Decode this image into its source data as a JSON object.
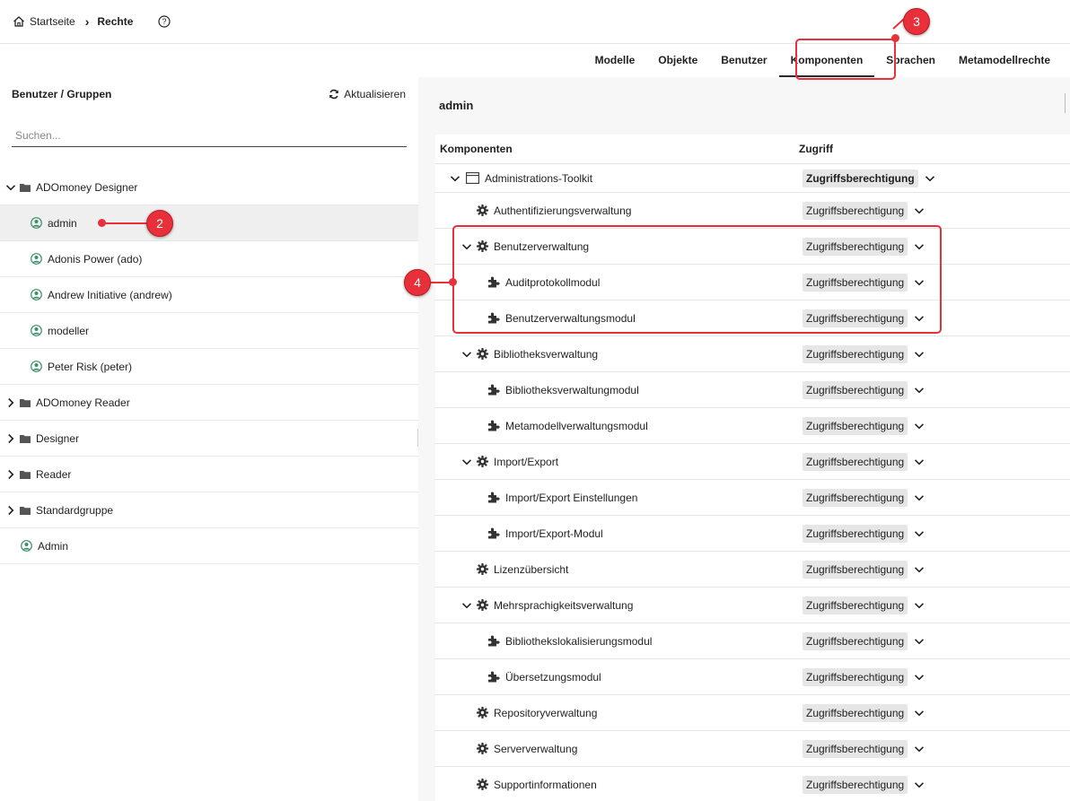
{
  "breadcrumb": {
    "home": "Startseite",
    "current": "Rechte"
  },
  "tabs": [
    "Modelle",
    "Objekte",
    "Benutzer",
    "Komponenten",
    "Sprachen",
    "Metamodellrechte"
  ],
  "active_tab": "Komponenten",
  "left": {
    "title": "Benutzer / Gruppen",
    "refresh": "Aktualisieren",
    "search_placeholder": "Suchen...",
    "tree": [
      {
        "label": "ADOmoney Designer",
        "type": "group",
        "expanded": true
      },
      {
        "label": "admin",
        "type": "user",
        "selected": true
      },
      {
        "label": "Adonis Power (ado)",
        "type": "user"
      },
      {
        "label": "Andrew Initiative (andrew)",
        "type": "user"
      },
      {
        "label": "modeller",
        "type": "user"
      },
      {
        "label": "Peter Risk (peter)",
        "type": "user"
      },
      {
        "label": "ADOmoney Reader",
        "type": "group"
      },
      {
        "label": "Designer",
        "type": "group"
      },
      {
        "label": "Reader",
        "type": "group"
      },
      {
        "label": "Standardgruppe",
        "type": "group"
      },
      {
        "label": "Admin",
        "type": "user-root"
      }
    ]
  },
  "right": {
    "user": "admin",
    "col_components": "Komponenten",
    "col_access": "Zugriff",
    "rows": [
      {
        "label": "Administrations-Toolkit",
        "level": 0,
        "icon": "window",
        "expand": true,
        "access": "Zugriffsberechtigung"
      },
      {
        "label": "Authentifizierungsverwaltung",
        "level": 1,
        "icon": "gear",
        "expand": false,
        "access": "Zugriffsberechtigung"
      },
      {
        "label": "Benutzerverwaltung",
        "level": 1,
        "icon": "gear",
        "expand": true,
        "access": "Zugriffsberechtigung"
      },
      {
        "label": "Auditprotokollmodul",
        "level": 2,
        "icon": "puzzle",
        "expand": false,
        "access": "Zugriffsberechtigung"
      },
      {
        "label": "Benutzerverwaltungsmodul",
        "level": 2,
        "icon": "puzzle",
        "expand": false,
        "access": "Zugriffsberechtigung"
      },
      {
        "label": "Bibliotheksverwaltung",
        "level": 1,
        "icon": "gear",
        "expand": true,
        "access": "Zugriffsberechtigung"
      },
      {
        "label": "Bibliotheksverwaltungmodul",
        "level": 2,
        "icon": "puzzle",
        "expand": false,
        "access": "Zugriffsberechtigung"
      },
      {
        "label": "Metamodellverwaltungsmodul",
        "level": 2,
        "icon": "puzzle",
        "expand": false,
        "access": "Zugriffsberechtigung"
      },
      {
        "label": "Import/Export",
        "level": 1,
        "icon": "gear",
        "expand": true,
        "access": "Zugriffsberechtigung"
      },
      {
        "label": "Import/Export Einstellungen",
        "level": 2,
        "icon": "puzzle",
        "expand": false,
        "access": "Zugriffsberechtigung"
      },
      {
        "label": "Import/Export-Modul",
        "level": 2,
        "icon": "puzzle",
        "expand": false,
        "access": "Zugriffsberechtigung"
      },
      {
        "label": "Lizenzübersicht",
        "level": 1,
        "icon": "gear",
        "expand": false,
        "access": "Zugriffsberechtigung"
      },
      {
        "label": "Mehrsprachigkeitsverwaltung",
        "level": 1,
        "icon": "gear",
        "expand": true,
        "access": "Zugriffsberechtigung"
      },
      {
        "label": "Bibliothekslokalisierungsmodul",
        "level": 2,
        "icon": "puzzle",
        "expand": false,
        "access": "Zugriffsberechtigung"
      },
      {
        "label": "Übersetzungsmodul",
        "level": 2,
        "icon": "puzzle",
        "expand": false,
        "access": "Zugriffsberechtigung"
      },
      {
        "label": "Repositoryverwaltung",
        "level": 1,
        "icon": "gear",
        "expand": false,
        "access": "Zugriffsberechtigung"
      },
      {
        "label": "Serververwaltung",
        "level": 1,
        "icon": "gear",
        "expand": false,
        "access": "Zugriffsberechtigung"
      },
      {
        "label": "Supportinformationen",
        "level": 1,
        "icon": "gear",
        "expand": false,
        "access": "Zugriffsberechtigung"
      }
    ]
  },
  "annotations": [
    "2",
    "3",
    "4"
  ],
  "colors": {
    "annotation": "#e8303a",
    "selected_row": "#efefef",
    "badge": "#e6e6e6"
  }
}
